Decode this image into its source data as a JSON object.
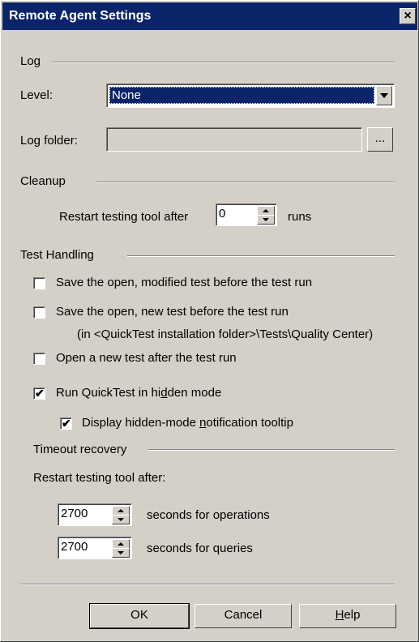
{
  "window": {
    "title": "Remote Agent Settings",
    "close_glyph": "×"
  },
  "log": {
    "section_label": "Log",
    "level_label": "Level:",
    "level_value": "None",
    "folder_label": "Log folder:",
    "folder_value": "",
    "browse_label": "..."
  },
  "cleanup": {
    "section_label": "Cleanup",
    "restart_label": "Restart testing tool after",
    "runs_value": "0",
    "runs_suffix": "runs"
  },
  "test_handling": {
    "section_label": "Test Handling",
    "options": [
      {
        "label": "Save the open, modified test before the test run",
        "checked": false
      },
      {
        "label": "Save the open, new test before the test run",
        "checked": false
      },
      {
        "label": "Open a new test after the test run",
        "checked": false
      },
      {
        "label_pre": "Run QuickTest in hi",
        "label_u": "d",
        "label_post": "den mode",
        "checked": true
      },
      {
        "label_pre": "Display hidden-mode ",
        "label_u": "n",
        "label_post": "otification tooltip",
        "checked": true
      }
    ],
    "new_test_note": "(in <QuickTest installation folder>\\Tests\\Quality Center)",
    "check_glyph": "✔"
  },
  "timeout": {
    "section_label": "Timeout recovery",
    "restart_label": "Restart testing tool after:",
    "operations_value": "2700",
    "operations_suffix": "seconds for operations",
    "queries_value": "2700",
    "queries_suffix": "seconds for queries"
  },
  "buttons": {
    "ok": "OK",
    "cancel": "Cancel",
    "help_u": "H",
    "help_rest": "elp"
  }
}
